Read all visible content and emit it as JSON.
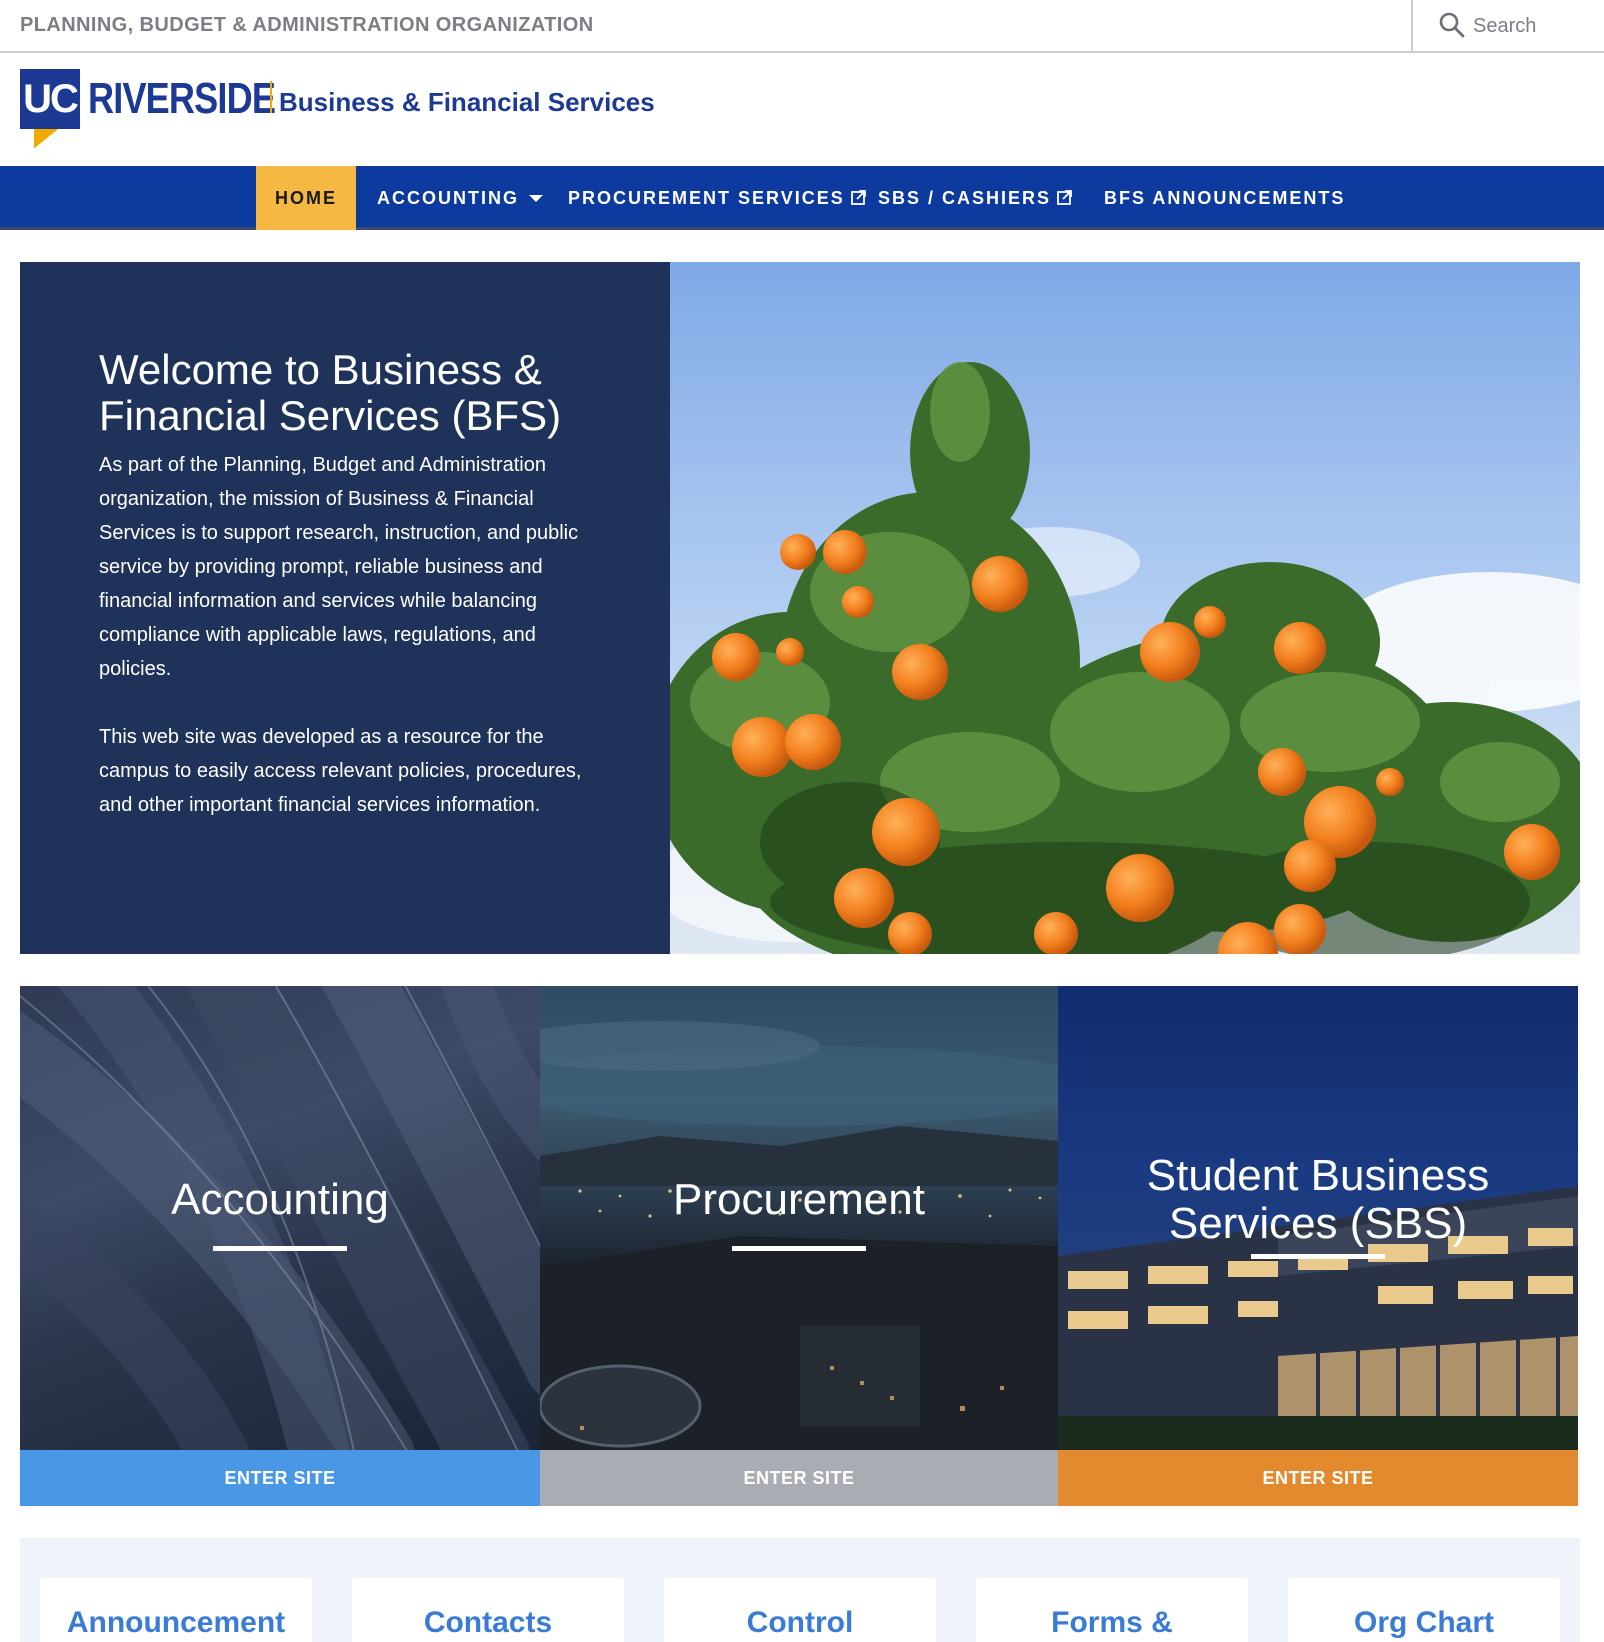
{
  "utility": {
    "org_name": "PLANNING, BUDGET & ADMINISTRATION ORGANIZATION",
    "search_placeholder": "Search"
  },
  "header": {
    "uc_letters": "UC",
    "riverside": "RIVERSIDE",
    "unit_name": "Business & Financial Services",
    "brand_blue": "#1c3a94",
    "brand_gold": "#f1ab00"
  },
  "nav": {
    "items": [
      {
        "label": "HOME",
        "active": true
      },
      {
        "label": "ACCOUNTING",
        "has_dropdown": true
      },
      {
        "label": "PROCUREMENT SERVICES",
        "external": true
      },
      {
        "label": "SBS / CASHIERS",
        "external": true
      },
      {
        "label": "BFS ANNOUNCEMENTS"
      }
    ],
    "bg_color": "#0d3a9e",
    "active_color": "#f4b843"
  },
  "hero": {
    "title": "Welcome to Business & Financial Services (BFS)",
    "paragraph_1": "As part of the Planning, Budget and Administration organization, the mission of Business & Financial Services is to support research, instruction, and public service by providing prompt, reliable business and financial information and services while balancing compliance with applicable laws, regulations, and policies.",
    "paragraph_2": "This web site was developed as a resource for the campus to easily access relevant policies, procedures, and other important financial services information.",
    "bg_color": "#1f3259"
  },
  "cards": [
    {
      "title": "Accounting",
      "button": "ENTER SITE",
      "button_color": "#4a97e6"
    },
    {
      "title": "Procurement",
      "button": "ENTER SITE",
      "button_color": "#a9adb3"
    },
    {
      "title": "Student Business Services (SBS)",
      "button": "ENTER SITE",
      "button_color": "#e38a2e"
    }
  ],
  "quick_links": [
    {
      "label": "Announcement"
    },
    {
      "label": "Contacts"
    },
    {
      "label": "Control"
    },
    {
      "label": "Forms &"
    },
    {
      "label": "Org Chart"
    }
  ]
}
